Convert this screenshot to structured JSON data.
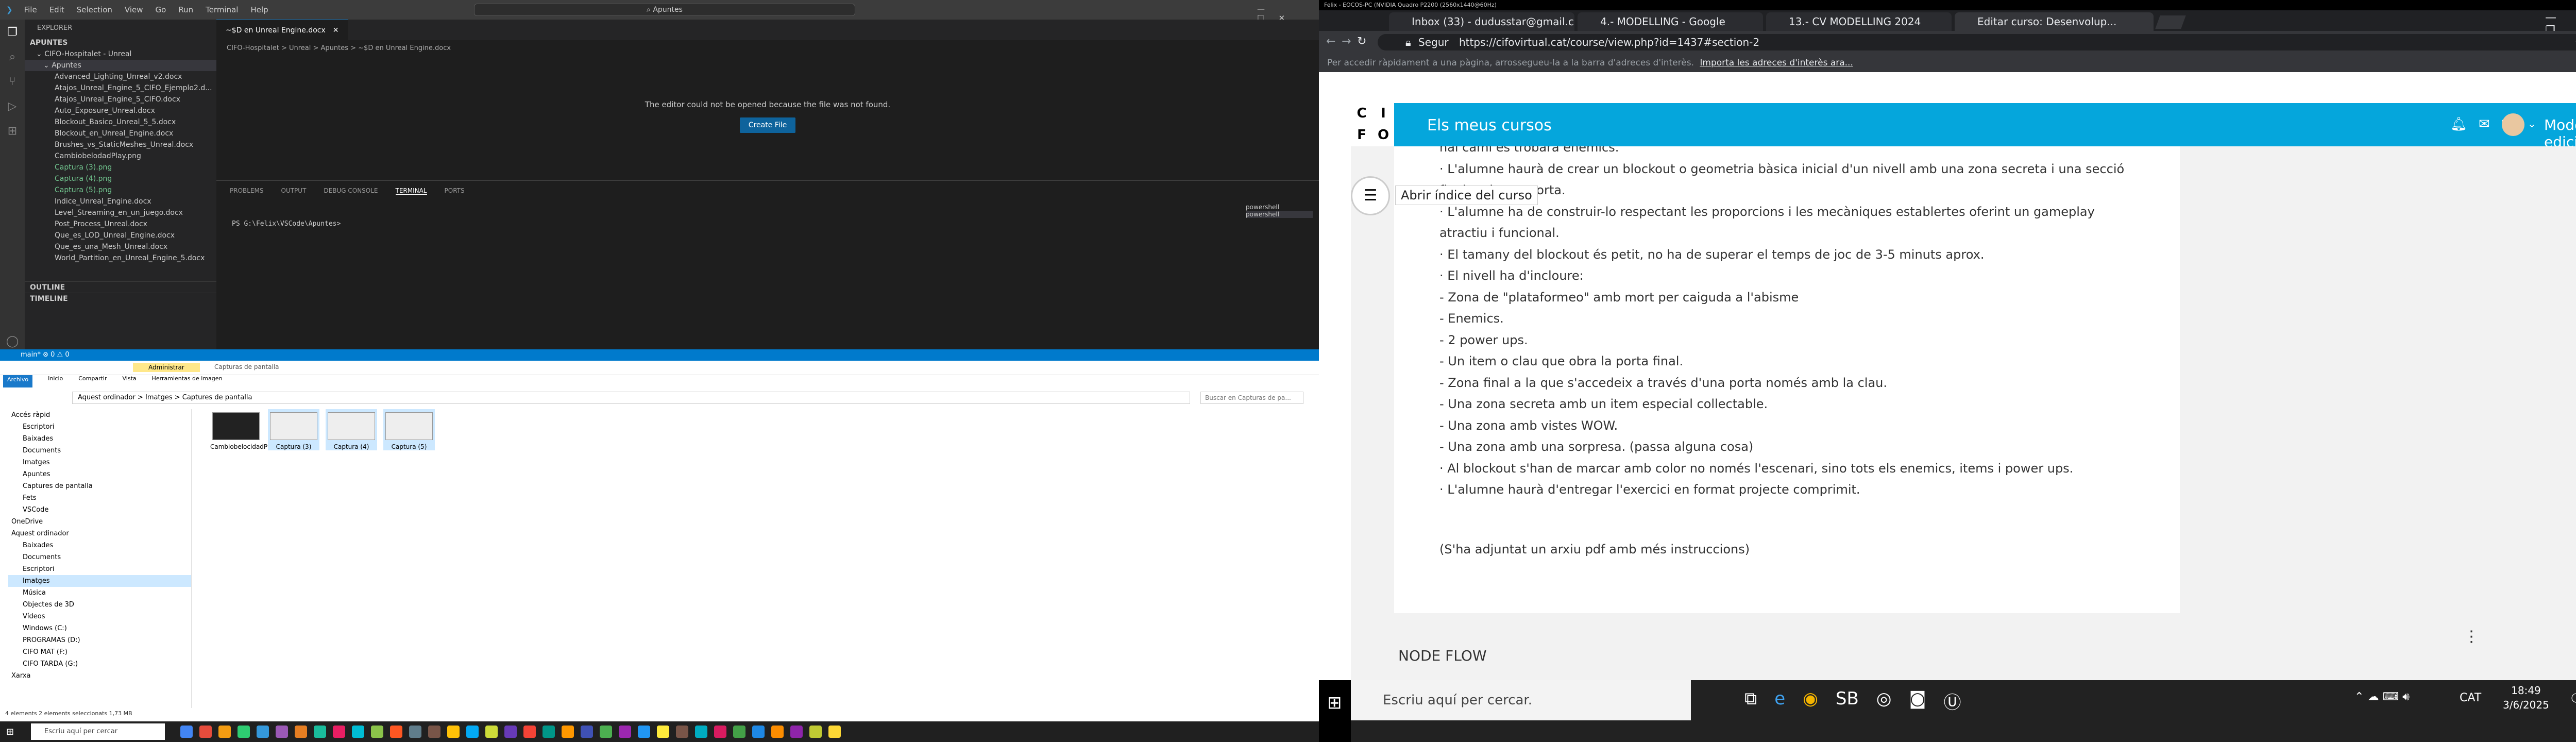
{
  "vscode": {
    "menu": [
      "File",
      "Edit",
      "Selection",
      "View",
      "Go",
      "Run",
      "Terminal",
      "Help"
    ],
    "search": "Apuntes",
    "explorer_header": "EXPLORER",
    "section": "APUNTES",
    "root_folder": "CIFO-Hospitalet - Unreal",
    "sub_folder": "Apuntes",
    "files": [
      "Advanced_Lighting_Unreal_v2.docx",
      "Atajos_Unreal_Engine_5_CIFO_Ejemplo2.d...",
      "Atajos_Unreal_Engine_5_CIFO.docx",
      "Auto_Exposure_Unreal.docx",
      "Blockout_Basico_Unreal_5_5.docx",
      "Blockout_en_Unreal_Engine.docx",
      "Brushes_vs_StaticMeshes_Unreal.docx",
      "CambiobelodadPlay.png",
      "Captura (3).png",
      "Captura (4).png",
      "Captura (5).png",
      "Indice_Unreal_Engine.docx",
      "Level_Streaming_en_un_juego.docx",
      "Post_Process_Unreal.docx",
      "Que_es_LOD_Unreal_Engine.docx",
      "Que_es_una_Mesh_Unreal.docx",
      "World_Partition_en_Unreal_Engine_5.docx"
    ],
    "outline": "OUTLINE",
    "timeline": "TIMELINE",
    "tab": "~$D en Unreal Engine.docx",
    "breadcrumb": "CIFO-Hospitalet > Unreal > Apuntes > ~$D en Unreal Engine.docx",
    "editor_msg": "The editor could not be opened because the file was not found.",
    "create_btn": "Create File",
    "panel_tabs": [
      "PROBLEMS",
      "OUTPUT",
      "DEBUG CONSOLE",
      "TERMINAL",
      "PORTS"
    ],
    "terminal_line": "PS G:\\Felix\\VSCode\\Apuntes>",
    "terminals": [
      "powershell",
      "powershell"
    ],
    "status_left": "main*  ⊗ 0 ⚠ 0"
  },
  "explorer": {
    "title": "Capturas de pantalla",
    "ribbon_tabs": [
      "Archivo",
      "Inicio",
      "Compartir",
      "Vista",
      "Herramientas de imagen"
    ],
    "manage_tab": "Administrar",
    "path": "Aquest ordinador  >  Imatges  >  Captures de pantalla",
    "search_ph": "Buscar en Capturas de pa...",
    "nav_items": [
      "Accés ràpid",
      "Escriptori",
      "Baixades",
      "Documents",
      "Imatges",
      "Apuntes",
      "Captures de pantalla",
      "Fets",
      "VSCode",
      "OneDrive",
      "Aquest ordinador",
      "Baixades",
      "Documents",
      "Escriptori",
      "Imatges",
      "Música",
      "Objectes de 3D",
      "Vídeos",
      "Windows (C:)",
      "PROGRAMAS (D:)",
      "CIFO MAT (F:)",
      "CIFO TARDA (G:)",
      "Xarxa"
    ],
    "thumbs": [
      "CambiobelocidadPlay",
      "Captura (3)",
      "Captura (4)",
      "Captura (5)"
    ],
    "status": "4 elements    2 elements seleccionats  1,73 MB"
  },
  "taskbar1": {
    "search": "Escriu aquí per cercar"
  },
  "chrome": {
    "window_title": "Felix - EOCOS-PC (NVIDIA Quadro P2200 (2560x1440@60Hz)",
    "tabs": [
      "Inbox (33) - dudusstar@gmail.com",
      "4.- MODELLING - Google",
      "13.- CV MODELLING 2024",
      "Editar curso: Desenvolup..."
    ],
    "secure": "Segur",
    "url": "https://cifovirtual.cat/course/view.php?id=1437#section-2",
    "infobar": "Per accedir ràpidament a una pàgina, arrossegueu-la a la barra d'adreces d'interès.",
    "infobar_link": "Importa les adreces d'interès ara...",
    "logo": [
      "C",
      "I",
      "F",
      "O"
    ],
    "nav_title": "Els meus cursos",
    "edit_mode": "Modo de edición",
    "tooltip": "Abrir índice del curso",
    "lines": [
      "nal camí es trobarà enemics.",
      "· L'alumne haurà de crear un blockout o geometria bàsica inicial d'un nivell amb una zona secreta i una secció",
      "final amb una porta.",
      "· L'alumne ha de construir-lo respectant les proporcions i les mecàniques establertes oferint un gameplay",
      "atractiu i funcional.",
      "· El tamany del blockout és petit, no ha de superar el temps de joc de 3-5 minuts aprox.",
      "· El nivell ha d'incloure:",
      "- Zona de \"plataformeo\" amb mort per caiguda a l'abisme",
      "- Enemics.",
      "- 2 power ups.",
      "- Un item o clau que obra la porta final.",
      "- Zona final a la que s'accedeix a través d'una porta només amb la clau.",
      "- Una zona secreta amb un item especial collectable.",
      "- Una zona amb vistes WOW.",
      "- Una zona amb una sorpresa. (passa alguna cosa)",
      "· Al blockout s'han de marcar amb color no només l'escenari, sino tots els enemics, items i power ups.",
      "· L'alumne haurà d'entregar l'exercici en format projecte comprimit."
    ],
    "attach_note": "(S'ha adjuntat un arxiu pdf amb més instruccions)",
    "node_flow": "NODE FLOW",
    "taskbar_search": "Escriu aquí per cercar.",
    "time": "18:49",
    "date": "3/6/2025",
    "lang": "CAT",
    "sb": "SB"
  }
}
